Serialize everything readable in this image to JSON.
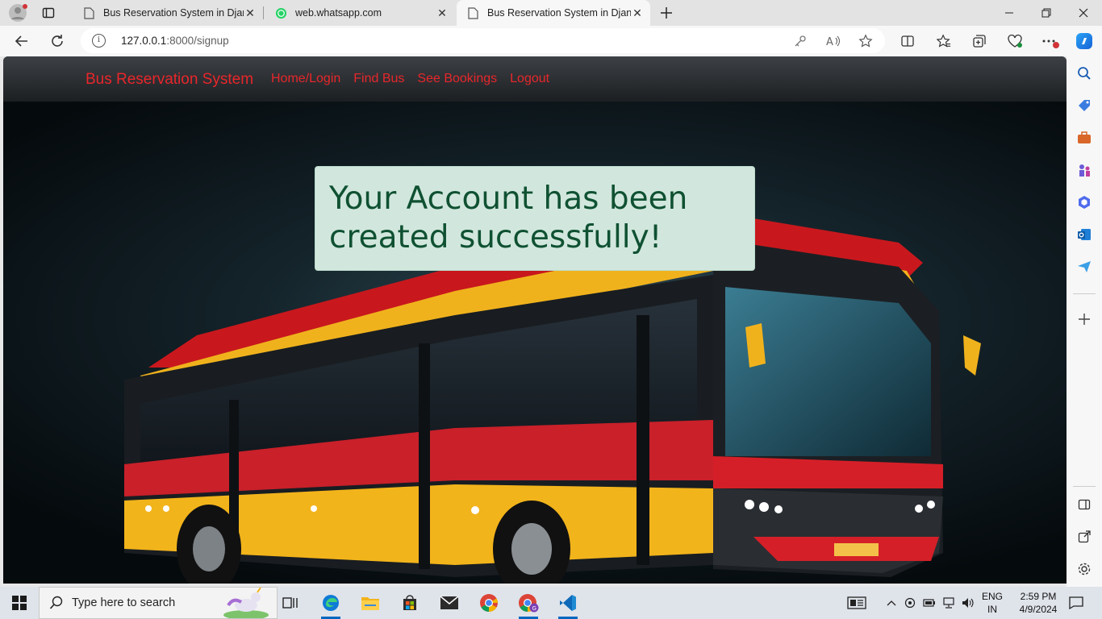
{
  "browser": {
    "tabs": [
      {
        "title": "Bus Reservation System in Djang",
        "active": false
      },
      {
        "title": "web.whatsapp.com",
        "active": false
      },
      {
        "title": "Bus Reservation System in Djang",
        "active": true
      }
    ],
    "address": {
      "host": "127.0.0.1",
      "path": ":8000/signup"
    },
    "accent": "#1f1f1f"
  },
  "site": {
    "brand": "Bus Reservation System",
    "nav": [
      "Home/Login",
      "Find Bus",
      "See Bookings",
      "Logout"
    ],
    "link_color": "#e8262b",
    "alert": {
      "message": "Your Account has been created successfully!",
      "color": "#0f5132",
      "background": "#d1e7dd"
    }
  },
  "edge_sidebar": {
    "icons": [
      "search-icon",
      "tag-icon",
      "briefcase-icon",
      "chess-icon",
      "m365-icon",
      "outlook-icon",
      "send-icon",
      "add-icon"
    ]
  },
  "taskbar": {
    "search_placeholder": "Type here to search",
    "apps": [
      "task-view-icon",
      "edge-icon",
      "file-explorer-icon",
      "store-icon",
      "mail-icon",
      "chrome-icon",
      "chrome-profile-icon",
      "vscode-icon"
    ],
    "language": "ENG",
    "region": "IN",
    "time": "2:59 PM",
    "date": "4/9/2024"
  }
}
